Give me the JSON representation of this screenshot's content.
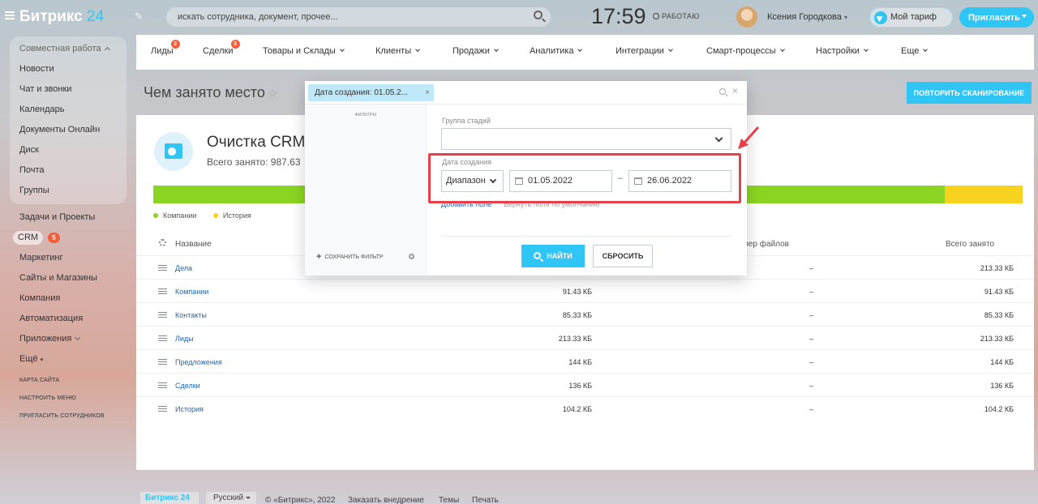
{
  "header": {
    "logo_text": "Битрикс",
    "logo_num": "24",
    "search_placeholder": "искать сотрудника, документ, прочее...",
    "clock": "17:59",
    "status": "РАБОТАЮ",
    "user_name": "Ксения Городкова",
    "tariff_label": "Мой тариф",
    "invite_label": "Пригласить"
  },
  "sidebar": {
    "group_head": "Совместная работа",
    "group_items": [
      "Новости",
      "Чат и звонки",
      "Календарь",
      "Документы Онлайн",
      "Диск",
      "Почта",
      "Группы"
    ],
    "items": [
      "Задачи и Проекты",
      "CRM",
      "Маркетинг",
      "Сайты и Магазины",
      "Компания",
      "Автоматизация",
      "Приложения",
      "Ещё"
    ],
    "crm_badge": "5",
    "links": [
      "КАРТА САЙТА",
      "НАСТРОИТЬ МЕНЮ",
      "ПРИГЛАСИТЬ СОТРУДНИКОВ"
    ]
  },
  "tabs": [
    {
      "label": "Лиды",
      "count": "2"
    },
    {
      "label": "Сделки",
      "count": "3"
    },
    {
      "label": "Товары и Склады",
      "count": ""
    },
    {
      "label": "Клиенты",
      "count": ""
    },
    {
      "label": "Продажи",
      "count": ""
    },
    {
      "label": "Аналитика",
      "count": ""
    },
    {
      "label": "Интеграции",
      "count": ""
    },
    {
      "label": "Смарт-процессы",
      "count": ""
    },
    {
      "label": "Настройки",
      "count": ""
    },
    {
      "label": "Еще",
      "count": ""
    }
  ],
  "page": {
    "title": "Чем занято место",
    "rescan_label": "ПОВТОРИТЬ СКАНИРОВАНИЕ",
    "cleanup_title": "Очистка CRM",
    "used_total": "Всего занято: 987.63",
    "usage_history_fraction": 0.09,
    "legend": [
      {
        "label": "Компании",
        "color": "#8bd522"
      },
      {
        "label": "История",
        "color": "#f7d31f"
      }
    ]
  },
  "table": {
    "col_name": "Название",
    "col_files": "мер файлов",
    "col_total": "Всего занято",
    "rows": [
      {
        "name": "Дела",
        "size": "",
        "files": "–",
        "total": "213.33 КБ"
      },
      {
        "name": "Компании",
        "size": "91.43 КБ",
        "files": "–",
        "total": "91.43 КБ"
      },
      {
        "name": "Контакты",
        "size": "85.33 КБ",
        "files": "–",
        "total": "85.33 КБ"
      },
      {
        "name": "Лиды",
        "size": "213.33 КБ",
        "files": "–",
        "total": "213.33 КБ"
      },
      {
        "name": "Предложения",
        "size": "144 КБ",
        "files": "–",
        "total": "144 КБ"
      },
      {
        "name": "Сделки",
        "size": "136 КБ",
        "files": "–",
        "total": "136 КБ"
      },
      {
        "name": "История",
        "size": "104.2 КБ",
        "files": "–",
        "total": "104.2 КБ"
      }
    ]
  },
  "filter": {
    "chip": "Дата создания: 01.05.2...",
    "filters_title": "ФИЛЬТРЫ",
    "save_filter": "СОХРАНИТЬ ФИЛЬТР",
    "stage_group_label": "Группа стадий",
    "stage_group_value": "",
    "created_label": "Дата создания",
    "range_value": "Диапазон",
    "date_from": "01.05.2022",
    "date_to": "26.06.2022",
    "add_field": "Добавить поле",
    "restore_fields": "Вернуть поля по умолчанию",
    "find_label": "НАЙТИ",
    "reset_label": "СБРОСИТЬ"
  },
  "footer": {
    "logo": "Битрикс 24",
    "language": "Русский",
    "copyright": "© «Битрикс», 2022",
    "order": "Заказать внедрение",
    "themes": "Темы",
    "print": "Печать"
  }
}
